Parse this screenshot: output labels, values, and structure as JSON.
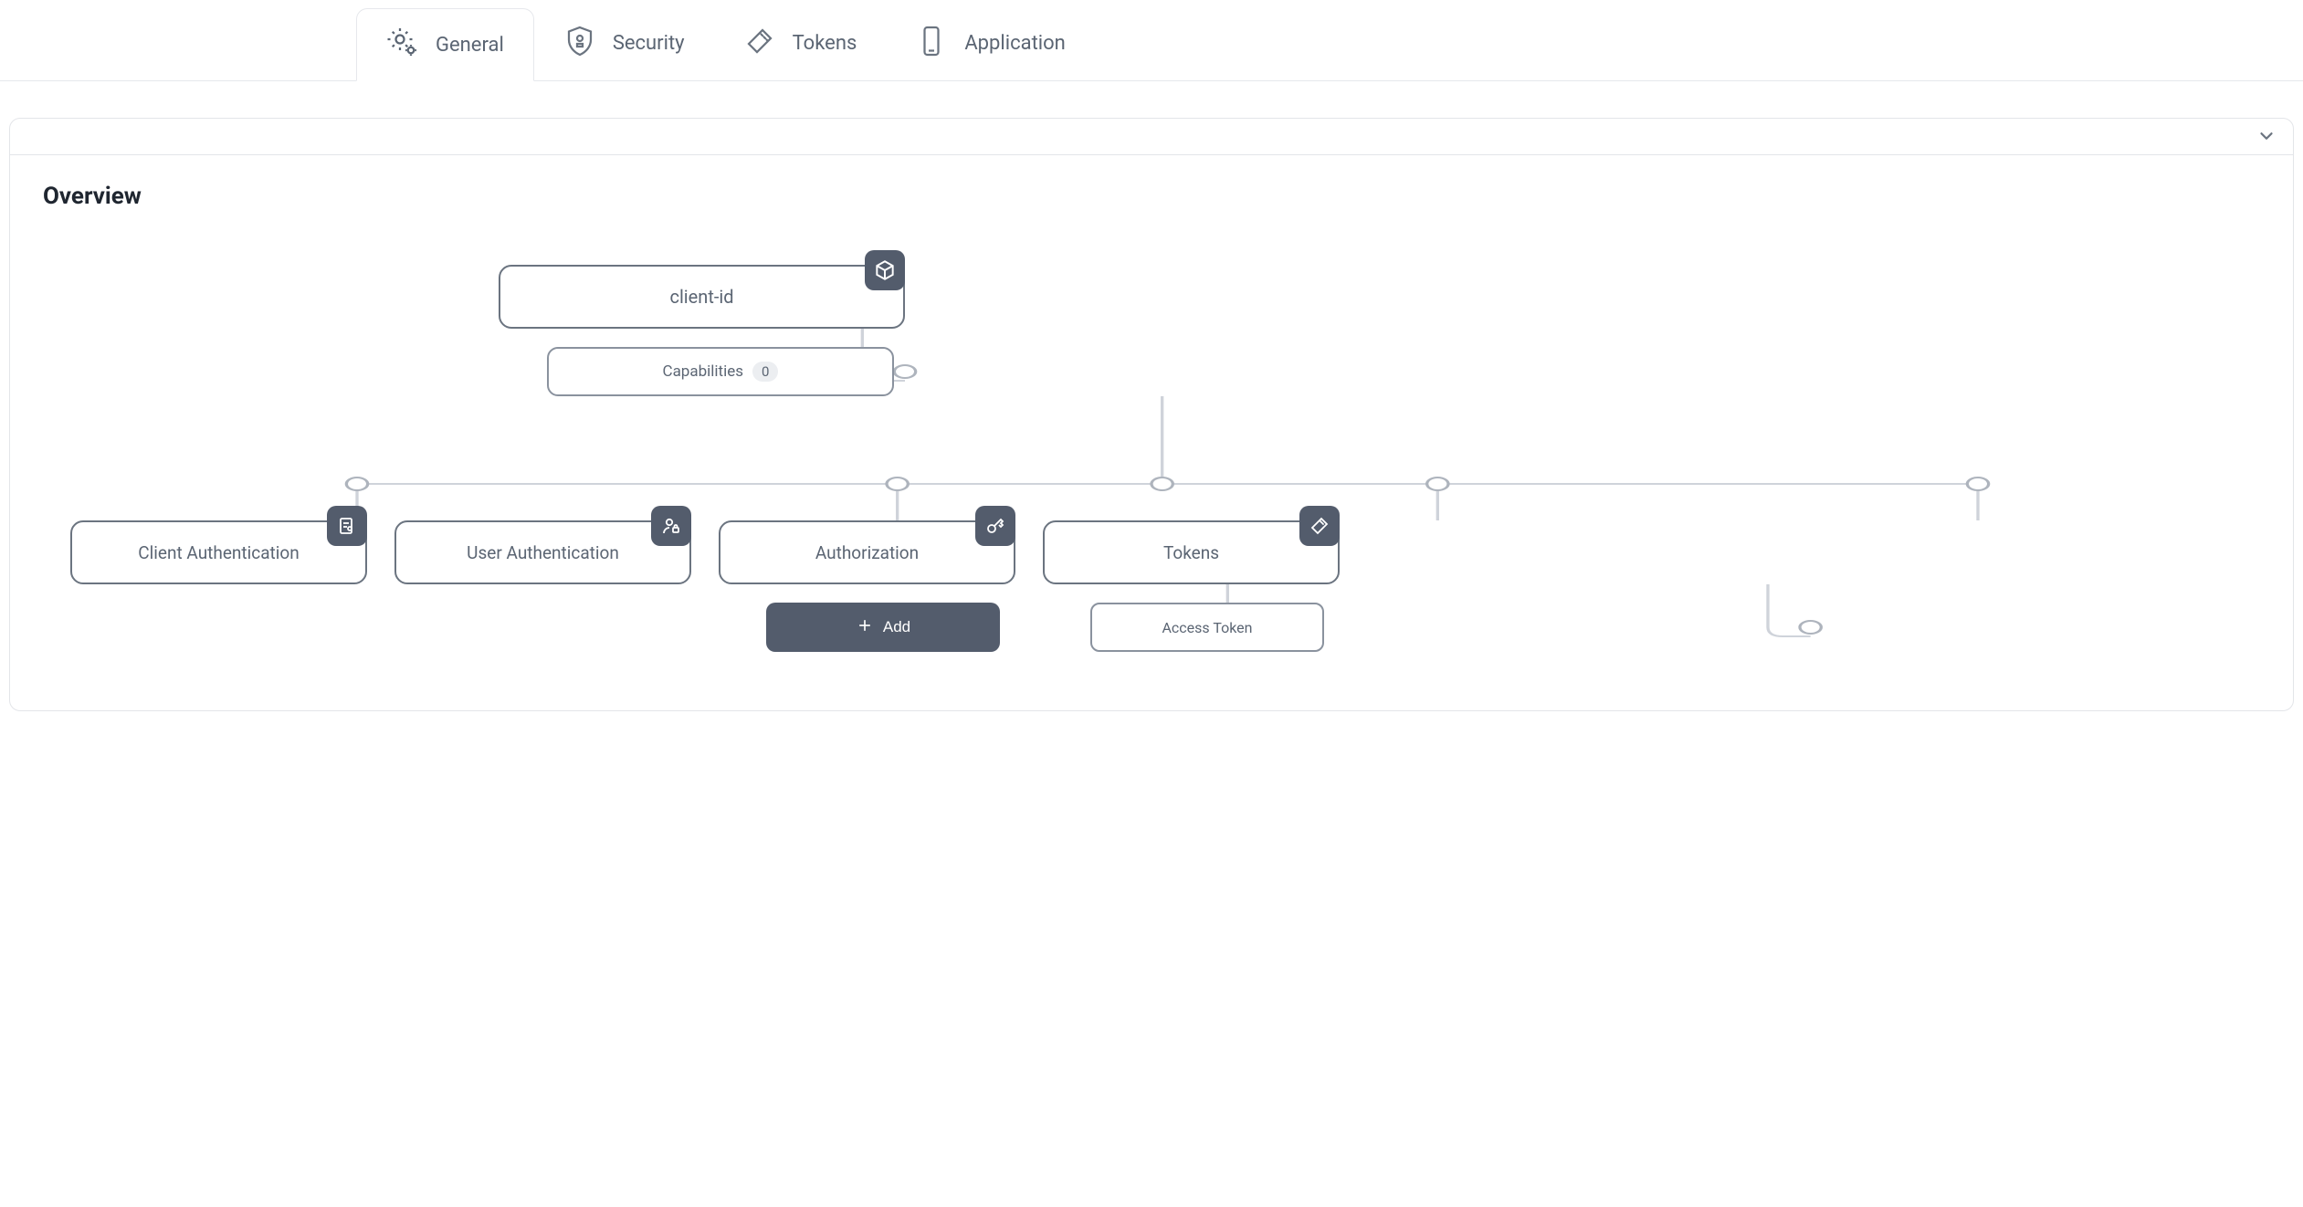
{
  "tabs": {
    "general": "General",
    "security": "Security",
    "tokens": "Tokens",
    "application": "Application",
    "active": "general"
  },
  "panel": {
    "title": "Overview"
  },
  "overview": {
    "root": {
      "label": "client-id"
    },
    "capabilities": {
      "label": "Capabilities",
      "count": "0"
    },
    "columns": {
      "client_auth": "Client Authentication",
      "user_auth": "User Authentication",
      "authorization": "Authorization",
      "tokens": "Tokens"
    },
    "authorization_add": "Add",
    "tokens_child": "Access Token"
  }
}
